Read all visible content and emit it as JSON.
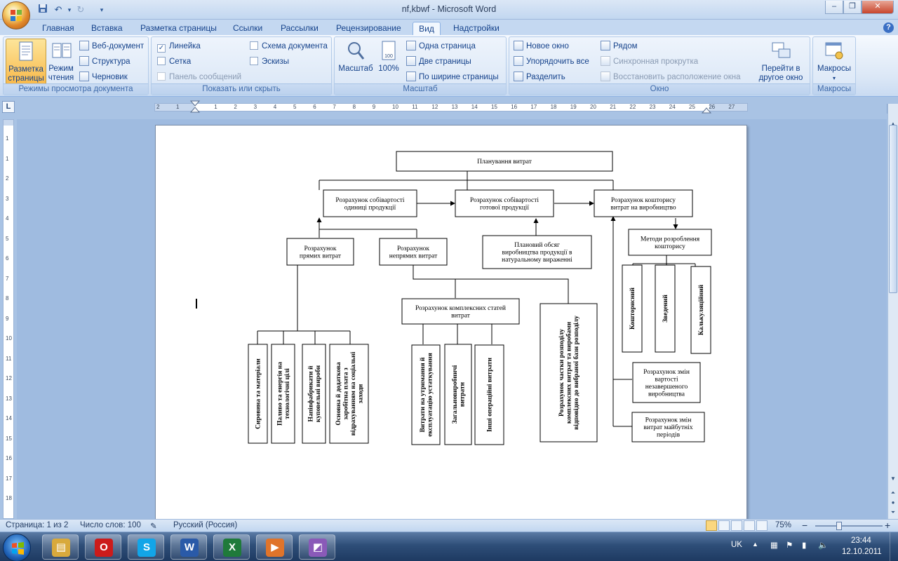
{
  "window": {
    "title": "nf,kbwf - Microsoft Word",
    "minimize": "–",
    "restore": "❐",
    "close": "✕"
  },
  "tabs": [
    "Главная",
    "Вставка",
    "Разметка страницы",
    "Ссылки",
    "Рассылки",
    "Рецензирование",
    "Вид",
    "Надстройки"
  ],
  "active_tab": "Вид",
  "ribbon": {
    "group_views": {
      "label": "Режимы просмотра документа",
      "print_layout": "Разметка страницы",
      "reading": "Режим чтения",
      "web": "Веб-документ",
      "outline": "Структура",
      "draft": "Черновик"
    },
    "group_show": {
      "label": "Показать или скрыть",
      "ruler": "Линейка",
      "gridlines": "Сетка",
      "message_bar": "Панель сообщений",
      "doc_map": "Схема документа",
      "thumbnails": "Эскизы",
      "ruler_checked": true,
      "gridlines_checked": false,
      "doc_map_checked": false,
      "thumbnails_checked": false
    },
    "group_zoom": {
      "label": "Масштаб",
      "zoom": "Масштаб",
      "hundred": "100%",
      "one_page": "Одна страница",
      "two_pages": "Две страницы",
      "page_width": "По ширине страницы"
    },
    "group_window": {
      "label": "Окно",
      "new_window": "Новое окно",
      "arrange_all": "Упорядочить все",
      "split": "Разделить",
      "side_by_side": "Рядом",
      "sync_scroll": "Синхронная прокрутка",
      "reset_pos": "Восстановить расположение окна",
      "switch_windows": "Перейти в другое окно"
    },
    "group_macros": {
      "label": "Макросы",
      "macros": "Макросы"
    }
  },
  "ruler": {
    "h_ticks": [
      "2",
      "1",
      "1",
      "2",
      "3",
      "4",
      "5",
      "6",
      "7",
      "8",
      "9",
      "10",
      "11",
      "12",
      "13",
      "14",
      "15",
      "16",
      "17",
      "18",
      "19",
      "20",
      "21",
      "22",
      "23",
      "24",
      "25",
      "26",
      "27"
    ],
    "v_ticks": [
      "1",
      "1",
      "2",
      "3",
      "4",
      "5",
      "6",
      "7",
      "8",
      "9",
      "10",
      "11",
      "12",
      "13",
      "14",
      "15",
      "16",
      "17",
      "18"
    ]
  },
  "diagram": {
    "root": "Планування витрат",
    "unit_cost": [
      "Розрахунок собівартості",
      "одиниці продукції"
    ],
    "finished_cost": [
      "Розрахунок собівартості",
      "готової продукції"
    ],
    "estimate": [
      "Розрахунок кошторису",
      "витрат на виробництво"
    ],
    "direct": [
      "Розрахунок",
      "прямих витрат"
    ],
    "indirect": [
      "Розрахунок",
      "непрямих витрат"
    ],
    "plan_volume": [
      "Плановий обсяг",
      "виробництва продукції в",
      "натуральному вираженні"
    ],
    "methods": [
      "Методи розроблення",
      "кошторису"
    ],
    "complex": [
      "Розрахунок комплексних статей",
      "витрат"
    ],
    "direct_items": [
      [
        "Сировина та матеріали"
      ],
      [
        "Паливо та енергія на",
        "технологічні цілі"
      ],
      [
        "Напівфабрикати й",
        "куповельні вироби"
      ],
      [
        "Основна й додаткова",
        "заробітна плата з",
        "відрахуванням на соціальні",
        "заходи"
      ]
    ],
    "complex_items": [
      [
        "Витрати на утримання й",
        "експлуатацію устаткування"
      ],
      [
        "Загальновиробничі",
        "витрати"
      ],
      [
        "Інші операційні витрати"
      ]
    ],
    "share": [
      "Розрахунок частки розподілу",
      "комплексних витрат та виробами",
      "відповідно до вибраної бази розподілу"
    ],
    "method_items": [
      [
        "Кошторисний"
      ],
      [
        "Зведений"
      ],
      [
        "Калькуляційний"
      ]
    ],
    "wip": [
      "Розрахунок змін",
      "вартості",
      "незавершеного",
      "виробництва"
    ],
    "future": [
      "Розрахунок змін",
      "витрат майбутніх",
      "періодів"
    ]
  },
  "status": {
    "page": "Страница: 1 из 2",
    "words": "Число слов: 100",
    "language": "Русский (Россия)",
    "zoom": "75%",
    "zoom_minus": "−",
    "zoom_plus": "+"
  },
  "taskbar": {
    "lang": "UK",
    "time": "23:44",
    "date": "12.10.2011",
    "apps": [
      {
        "name": "explorer",
        "glyph": "▤",
        "color": "#d8a93c"
      },
      {
        "name": "opera",
        "glyph": "O",
        "color": "#cc1b1b"
      },
      {
        "name": "skype",
        "glyph": "S",
        "color": "#12a5e8"
      },
      {
        "name": "word",
        "glyph": "W",
        "color": "#2a5aa8"
      },
      {
        "name": "excel",
        "glyph": "X",
        "color": "#1f7a3a"
      },
      {
        "name": "media",
        "glyph": "▶",
        "color": "#e0742a"
      },
      {
        "name": "app",
        "glyph": "◩",
        "color": "#8a5ab8"
      }
    ]
  }
}
